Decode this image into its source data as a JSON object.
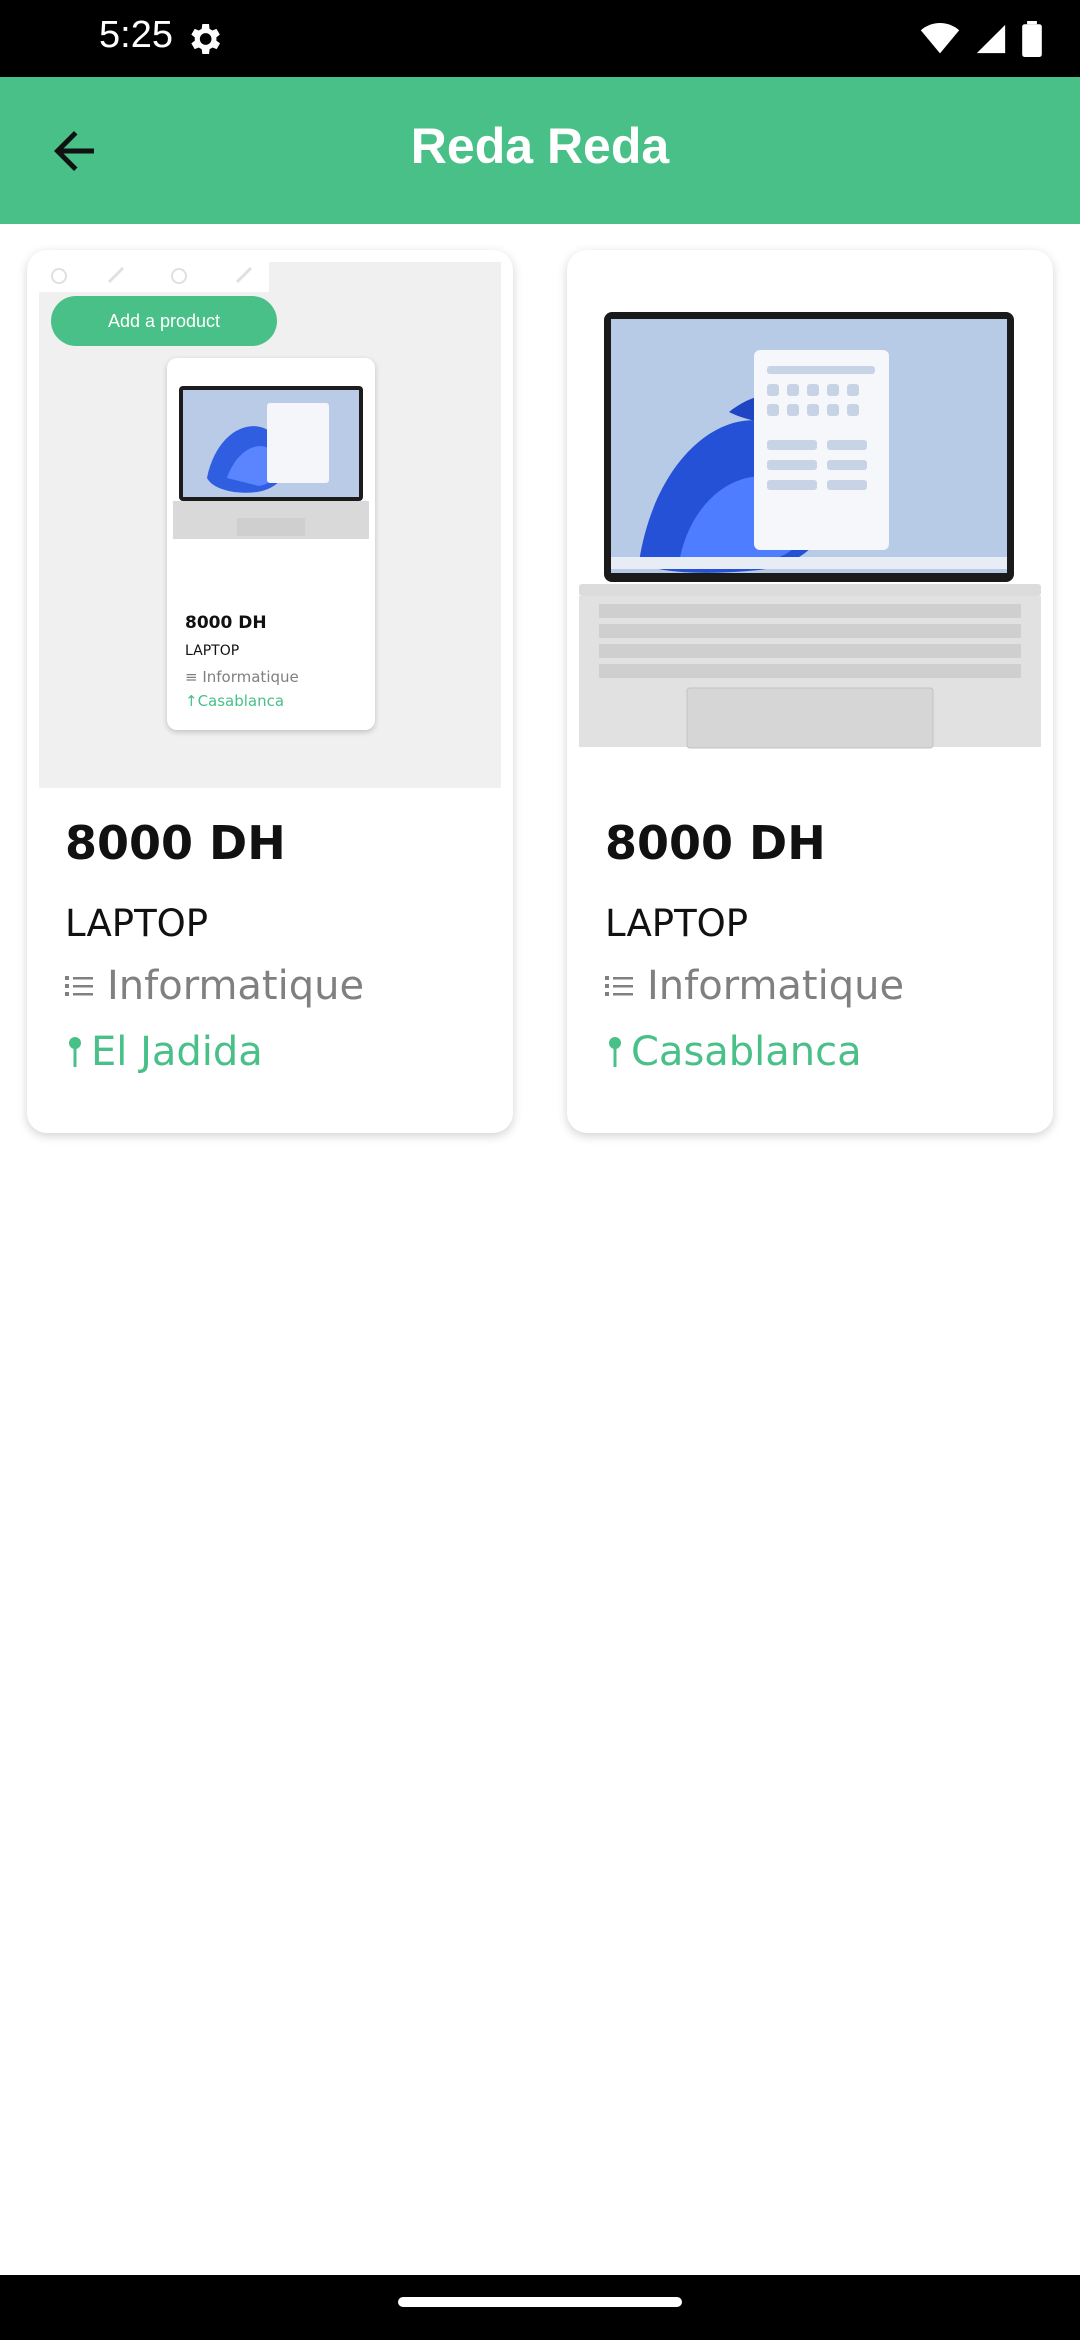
{
  "status_bar": {
    "time": "5:25"
  },
  "app_bar": {
    "title": "Reda Reda",
    "back_icon": "arrow-back-icon"
  },
  "products": [
    {
      "price": "8000 DH",
      "name": "LAPTOP",
      "category": "Informatique",
      "city": "El Jadida",
      "image": {
        "button_label": "Add a product",
        "price": "8000 DH",
        "name": "LAPTOP",
        "category": "≡ Informatique",
        "city": "↑Casablanca"
      }
    },
    {
      "price": "8000 DH",
      "name": "LAPTOP",
      "category": "Informatique",
      "city": "Casablanca"
    }
  ],
  "colors": {
    "accent": "#48c088",
    "muted": "#808080"
  }
}
